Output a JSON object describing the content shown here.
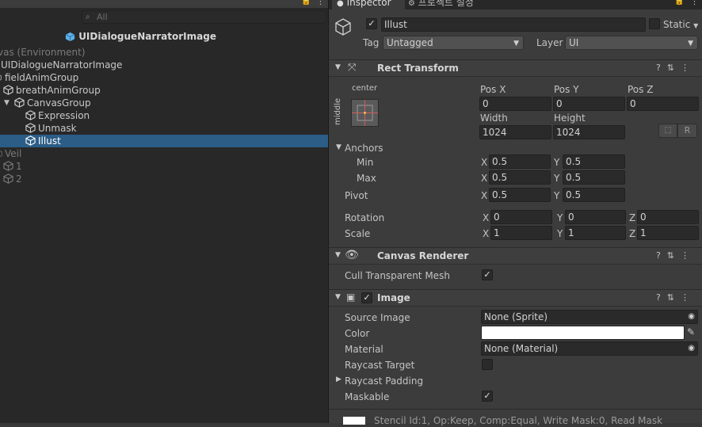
{
  "hierarchy": {
    "search_placeholder": "All",
    "scene_title": "UIDialogueNarratorImage",
    "rows": [
      {
        "label": "vas (Environment)"
      },
      {
        "label": "UIDialogueNarratorImage"
      },
      {
        "label": "fieldAnimGroup"
      },
      {
        "label": "breathAnimGroup"
      },
      {
        "label": "CanvasGroup"
      },
      {
        "label": "Expression"
      },
      {
        "label": "Unmask"
      },
      {
        "label": "Illust"
      },
      {
        "label": "Veil"
      },
      {
        "label": "1"
      },
      {
        "label": "2"
      }
    ]
  },
  "tabs": {
    "inspector": "Inspector",
    "project_settings": "프로젝트 설정"
  },
  "object": {
    "name": "Illust",
    "static_label": "Static",
    "tag_label": "Tag",
    "tag_value": "Untagged",
    "layer_label": "Layer",
    "layer_value": "UI"
  },
  "rect_transform": {
    "title": "Rect Transform",
    "anchor_preset_h": "center",
    "anchor_preset_v": "middle",
    "pos_x_label": "Pos X",
    "pos_x": "0",
    "pos_y_label": "Pos Y",
    "pos_y": "0",
    "pos_z_label": "Pos Z",
    "pos_z": "0",
    "width_label": "Width",
    "width": "1024",
    "height_label": "Height",
    "height": "1024",
    "r_button": "R",
    "anchors_label": "Anchors",
    "min_label": "Min",
    "min_x": "0.5",
    "min_y": "0.5",
    "max_label": "Max",
    "max_x": "0.5",
    "max_y": "0.5",
    "pivot_label": "Pivot",
    "pivot_x": "0.5",
    "pivot_y": "0.5",
    "rotation_label": "Rotation",
    "rot_x": "0",
    "rot_y": "0",
    "rot_z": "0",
    "scale_label": "Scale",
    "scale_x": "1",
    "scale_y": "1",
    "scale_z": "1",
    "x": "X",
    "y": "Y",
    "z": "Z"
  },
  "canvas_renderer": {
    "title": "Canvas Renderer",
    "cull_label": "Cull Transparent Mesh"
  },
  "image": {
    "title": "Image",
    "source_label": "Source Image",
    "source_value": "None (Sprite)",
    "color_label": "Color",
    "color_value": "#ffffff",
    "material_label": "Material",
    "material_value": "None (Material)",
    "raycast_target_label": "Raycast Target",
    "raycast_padding_label": "Raycast Padding",
    "maskable_label": "Maskable"
  },
  "footer": {
    "stencil_text": "Stencil Id:1, Op:Keep, Comp:Equal, Write Mask:0, Read Mask"
  }
}
